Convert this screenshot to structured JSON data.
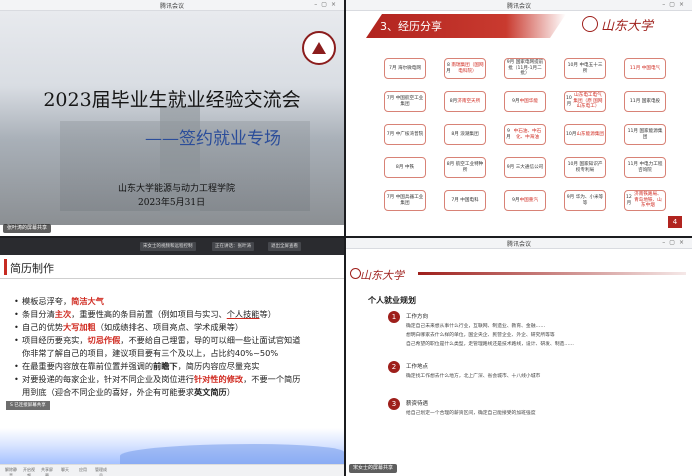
{
  "window_title": "腾讯会议",
  "pane1": {
    "title": "2023届毕业生就业经验交流会",
    "subtitle": "——签约就业专场",
    "org": "山东大学能源与动力工程学院",
    "date": "2023年5月31日",
    "share_label": "张叶涛的屏幕共享"
  },
  "pane2": {
    "section_title": "3、经历分享",
    "brand": "山东大学",
    "page_num": "4",
    "rows": [
      [
        {
          "t": "7月 海尔微电网"
        },
        {
          "t": "8月 南瑞集团（国网电科院）",
          "hl": true
        },
        {
          "t": "9月 国家电网提前批（11月-1月二批）",
          "hl_tail": true
        },
        {
          "t": "10月 中电五十三所"
        },
        {
          "t": "11月 中国电气",
          "red": true
        }
      ],
      [
        {
          "t": "7月 中国航空工业集团"
        },
        {
          "t": "8月 济南空天所",
          "hl": true
        },
        {
          "t": "9月 中国华能",
          "hl": true
        },
        {
          "t": "10月 山东电工电气集团（原 国网山东电工）",
          "hl": true
        },
        {
          "t": "11月 国家电投"
        }
      ],
      [
        {
          "t": "7月 中广核湾普院"
        },
        {
          "t": "8月 浪潮集团"
        },
        {
          "t": "9月 中石油、中石化、中海油",
          "hl": true
        },
        {
          "t": "10月 山东能源集团",
          "hl": true
        },
        {
          "t": "11月 国家能源集团"
        }
      ],
      [
        {
          "t": "8月 中铁"
        },
        {
          "t": "8月 航空工业特种所"
        },
        {
          "t": "9月 三大通信公司"
        },
        {
          "t": "10月 国家知识产权专利局"
        },
        {
          "t": "11月 中电力工程咨询院"
        }
      ],
      [
        {
          "t": "7月 中国兵器工业集团"
        },
        {
          "t": "7月 中国电科"
        },
        {
          "t": "9月 中国重汽",
          "hl": true
        },
        {
          "t": "9月 华为、小米等等"
        },
        {
          "t": "12月 济南铁路局、青岛地铁、山东中烟",
          "hl": true
        }
      ]
    ]
  },
  "pane3": {
    "toolbar_left": "宋女士的视频和远程控制",
    "toolbar_mid": "正在讲话：张叶涛",
    "toolbar_right": "退出全屏查看",
    "heading": "简历制作",
    "float_tag": "S 已连接屏幕共享",
    "bullets": [
      [
        "模板忌浮夸，",
        {
          "r": "简洁大气"
        }
      ],
      [
        "条目分清",
        {
          "r": "主次"
        },
        "，重要性高的条目前置（例如项目与实习、",
        {
          "u": "个人技能"
        },
        "等）"
      ],
      [
        "自己的优势",
        {
          "r": "大写加粗"
        },
        "（如成绩排名、项目亮点、学术成果等）"
      ],
      [
        "项目经历要充实，",
        {
          "r": "切忌作假"
        },
        "，不要给自己埋雷，导的可以细一些让面试官知道"
      ],
      [
        "你非常了解自己的项目，建议项目要有三个及以上，占比约40%~50%"
      ],
      [
        "在最重要内容放在靠前位置并强调的",
        {
          "b": "前瞻下"
        },
        "，简历内容应尽量充实"
      ],
      [
        "对要投递的每家企业，针对不同企业及岗位进行",
        {
          "r": "针对性的修改"
        },
        "，不要一个简历"
      ],
      [
        "用到底（迎合不同企业的喜好，外企有可能要求",
        {
          "b": "英文简历"
        },
        "）"
      ]
    ],
    "bottom_icons": [
      "解除静音",
      "开启视频",
      "共享屏幕",
      "聊天",
      "应用",
      "管理成员"
    ]
  },
  "pane4": {
    "brand": "山东大学",
    "section": "个人就业规划",
    "items": [
      {
        "n": "1",
        "title": "工作方向",
        "lines": [
          "确定自己未来想从事什么行业，互联网、制造业、教育、金融……",
          "想明白哪家去什么样的单位，国企央企、民营企业、外企、研究所等等",
          "自己希望的职位是什么类型，走管理路线还是技术路线，设计、研发、制造……"
        ]
      },
      {
        "n": "2",
        "title": "工作地点",
        "lines": [
          "确定找工作想去什么地方，北上广深、省会城市、十八线小城市"
        ]
      },
      {
        "n": "3",
        "title": "薪资待遇",
        "lines": [
          "给自己划定一个合理的薪资区间，确定自己能接受的加班强度"
        ]
      }
    ],
    "share_label": "宋女士的屏幕共享"
  }
}
